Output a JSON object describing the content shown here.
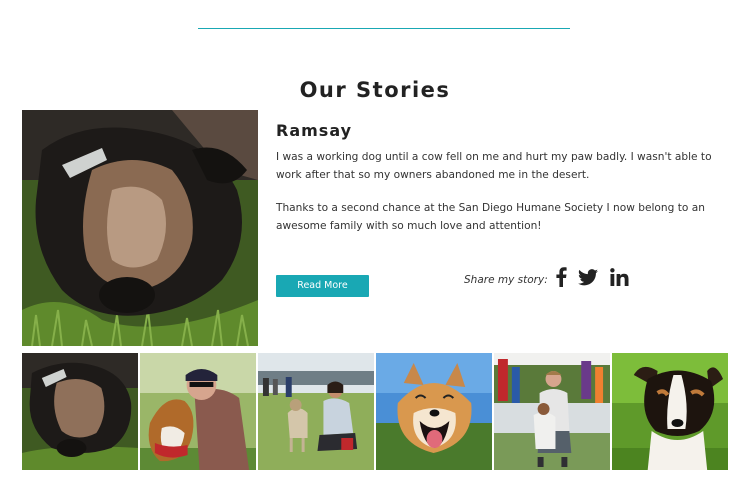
{
  "section": {
    "title": "Our Stories"
  },
  "story": {
    "name": "Ramsay",
    "paragraphs": [
      "I was a working dog until a cow fell on me and hurt my paw badly. I wasn't able to work after that so my owners abandoned me in the desert.",
      "Thanks to a second chance at the San Diego Humane Society I now belong to an awesome family with so much love and attention!"
    ],
    "read_more_label": "Read More",
    "share_label": "Share my story:"
  },
  "social_icons": [
    "facebook-icon",
    "twitter-icon",
    "linkedin-icon"
  ],
  "colors": {
    "accent": "#19a8b4",
    "text": "#333333",
    "heading": "#222222"
  }
}
